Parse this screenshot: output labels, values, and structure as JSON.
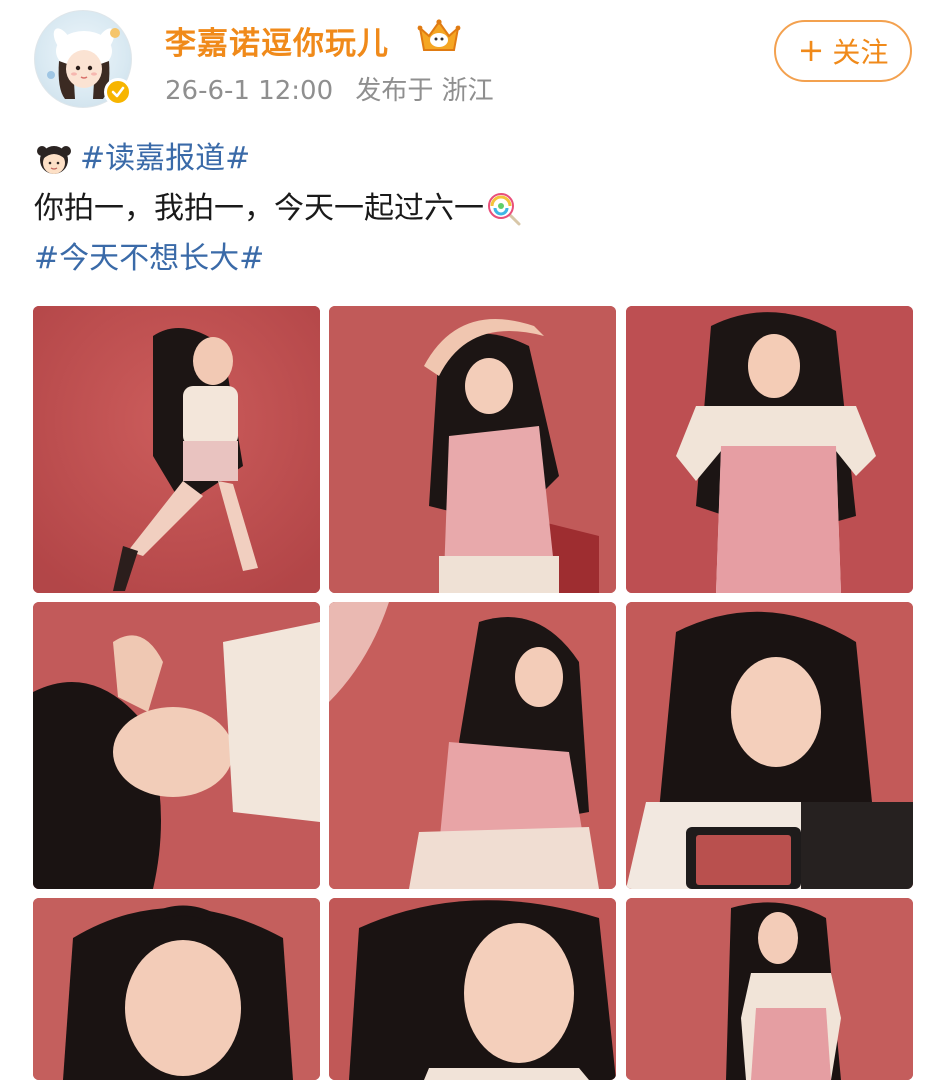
{
  "post": {
    "username": "李嘉诺逗你玩儿",
    "meta": {
      "time": "26-6-1 12:00",
      "source": "发布于 浙江"
    },
    "follow_label": "关注",
    "follow_icon": "plus-icon",
    "verified_icon": "verified-badge-icon",
    "crown_icon": "vip-crown-icon",
    "text": {
      "line1_tag": "#读嘉报道#",
      "line2": "你拍一，我拍一，今天一起过六一",
      "line3_tag": "#今天不想长大#"
    },
    "colors": {
      "username": "#f08a1a",
      "hashtag": "#3a6aa8",
      "meta": "#8f8f8f",
      "photo_bg": "#b84a4c"
    },
    "photos": [
      {
        "label": "photo-1"
      },
      {
        "label": "photo-2"
      },
      {
        "label": "photo-3"
      },
      {
        "label": "photo-4"
      },
      {
        "label": "photo-5"
      },
      {
        "label": "photo-6"
      },
      {
        "label": "photo-7"
      },
      {
        "label": "photo-8"
      },
      {
        "label": "photo-9"
      }
    ]
  }
}
